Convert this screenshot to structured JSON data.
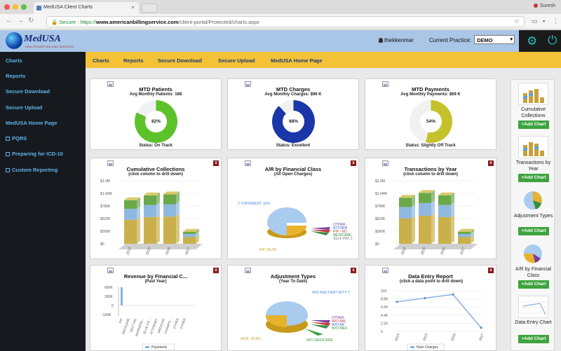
{
  "browser": {
    "tab_title": "MedUSA Client Charts",
    "user": "Suresh",
    "secure_label": "Secure",
    "url_scheme": "https://",
    "url_host": "www.americanbillingservice.com",
    "url_path": "/client-portal/Protected/charts.aspx"
  },
  "header": {
    "logo_text": "MedUSA",
    "logo_tagline": "HEALTHCARE BILLING SERVICES",
    "username": "thekkenmar",
    "practice_label": "Current Practice:",
    "practice_value": "DEMO"
  },
  "sidebar": {
    "items": [
      {
        "label": "Charts",
        "icon": ""
      },
      {
        "label": "Reports",
        "icon": ""
      },
      {
        "label": "Secure Download",
        "icon": ""
      },
      {
        "label": "Secure Upload",
        "icon": ""
      },
      {
        "label": "MedUSA Home Page",
        "icon": ""
      },
      {
        "label": "PQRS",
        "icon": "box-icon"
      },
      {
        "label": "Preparing for ICD-10",
        "icon": "box-icon"
      },
      {
        "label": "Custom Reporting",
        "icon": "box-icon"
      }
    ]
  },
  "menu": {
    "items": [
      "Charts",
      "Reports",
      "Secure Download",
      "Secure Upload",
      "MedUSA Home Page"
    ]
  },
  "colors": {
    "sidebar_bg": "#161a1e",
    "sidebar_link": "#5fb3e8",
    "menubar_bg": "#f3c236",
    "header_bg": "#a9c6e7",
    "add_chart_btn": "#3ea43e",
    "close_btn": "#8b1a1a"
  },
  "kpis": [
    {
      "title": "MTD Patients",
      "subtitle": "Avg Monthly Patients: 168",
      "value_label": "82%",
      "value": 82,
      "status": "Status: On Track",
      "color": "#5dc22a"
    },
    {
      "title": "MTD Charges",
      "subtitle": "Avg Monthly Charges: $96 K",
      "value_label": "88%",
      "value": 88,
      "status": "Status: Excellent",
      "color": "#1a36a8"
    },
    {
      "title": "MTD Payments",
      "subtitle": "Avg Monthly Payments: $69 K",
      "value_label": "54%",
      "value": 54,
      "status": "Status: Slightly Off Track",
      "color": "#c4c22a"
    }
  ],
  "charts": {
    "cumulative": {
      "title": "Cumulative Collections",
      "subtitle": "(click column to drill down)",
      "yticks": [
        "$1.3M",
        "$1.04M",
        "$780K",
        "$520K",
        "$260K",
        "$0"
      ],
      "categories": [
        "2014",
        "2015",
        "2016",
        "2017"
      ]
    },
    "ar": {
      "title": "A/R by Financial Class",
      "subtitle": "(All Open Charges)",
      "labels": [
        "Y STATEMENT, 55%",
        "OTHER,",
        "ATTORN",
        "PIP - NO",
        "MEDICARE",
        "SELF PAY, 1",
        "PIP, 34.2%"
      ]
    },
    "transactions": {
      "title": "Transactions by Year",
      "subtitle": "(click column to drill down)",
      "yticks": [
        "$1.3M",
        "$1.04M",
        "$780K",
        "$520K",
        "$260K",
        "$0"
      ],
      "categories": [
        "2014",
        "2015",
        "2016",
        "2017"
      ]
    },
    "revenue": {
      "title": "Revenue by Financial C...",
      "subtitle": "(Past Year)",
      "yticks": [
        "600K",
        "300K",
        "0",
        "-150K"
      ],
      "categories": [
        "PIP",
        "MEDICARE",
        "SELF PAY",
        "WORKERS...",
        "BLUE CR...",
        "ATTORNEY",
        "MEDICAID",
        "CHAMPS...",
        "OTHER",
        "OTHER"
      ],
      "legend": "Payments"
    },
    "adjustment": {
      "title": "Adjustment Types",
      "subtitle": "(Year To Date)",
      "labels": [
        "W/O BAD DEBT ATTY T",
        "OTHER,",
        "W/O BAL",
        "W/O AR",
        "W/O MED",
        "IACE, 26.6%",
        "W/O MEDICARE"
      ]
    },
    "dataentry": {
      "title": "Data Entry Report",
      "subtitle": "(click a data point to drill down)",
      "yticks": [
        "11K",
        "8.8K",
        "6.6K",
        "4.4K",
        "2.2K",
        "0"
      ],
      "categories": [
        "2014",
        "2015",
        "2016",
        "2017"
      ],
      "legend": "Num Charges"
    }
  },
  "rail": {
    "add_label": "+Add Chart",
    "items": [
      "Cumulative Collections",
      "Transactions by Year",
      "Adjustment Types",
      "A/R by Financial Class",
      "Data Entry Chart"
    ]
  },
  "chart_data": [
    {
      "type": "pie",
      "title": "MTD Patients",
      "values": [
        82,
        18
      ],
      "categories": [
        "complete",
        "remaining"
      ]
    },
    {
      "type": "pie",
      "title": "MTD Charges",
      "values": [
        88,
        12
      ],
      "categories": [
        "complete",
        "remaining"
      ]
    },
    {
      "type": "pie",
      "title": "MTD Payments",
      "values": [
        54,
        46
      ],
      "categories": [
        "complete",
        "remaining"
      ]
    },
    {
      "type": "bar",
      "title": "Cumulative Collections",
      "categories": [
        "2014",
        "2015",
        "2016",
        "2017"
      ],
      "series": [
        {
          "values": [
            900000,
            1000000,
            1020000,
            250000
          ]
        }
      ],
      "ylim": [
        0,
        1300000
      ]
    },
    {
      "type": "bar",
      "title": "Transactions by Year",
      "categories": [
        "2014",
        "2015",
        "2016",
        "2017"
      ],
      "series": [
        {
          "values": [
            950000,
            1050000,
            1000000,
            250000
          ]
        }
      ],
      "ylim": [
        0,
        1300000
      ]
    },
    {
      "type": "line",
      "title": "Data Entry Report",
      "categories": [
        "2014",
        "2015",
        "2016",
        "2017"
      ],
      "series": [
        {
          "name": "Num Charges",
          "values": [
            8000,
            9000,
            10000,
            1000
          ]
        }
      ],
      "ylim": [
        0,
        11000
      ]
    }
  ]
}
